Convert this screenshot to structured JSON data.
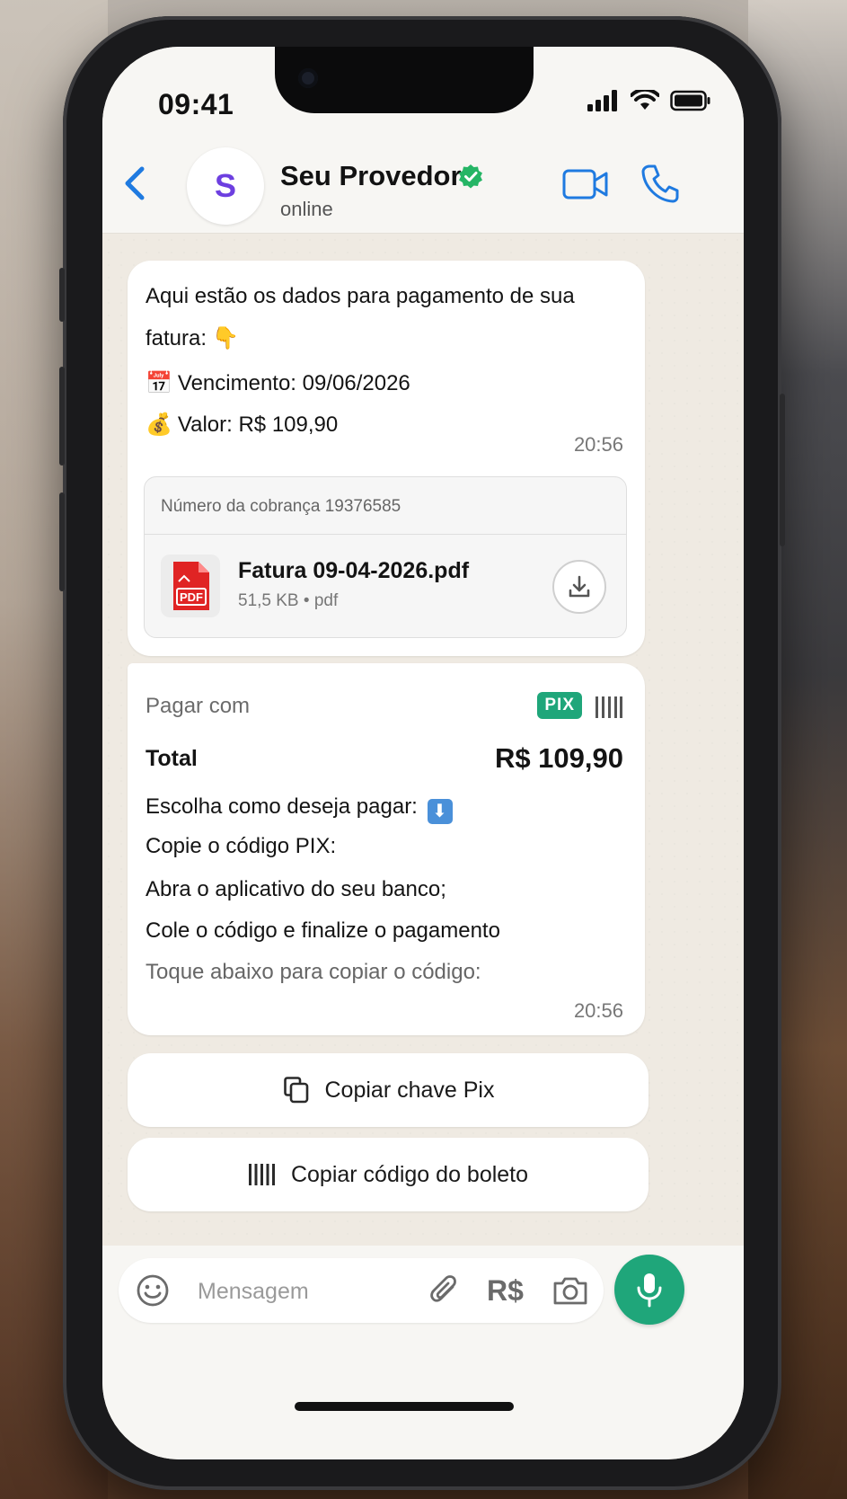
{
  "status": {
    "time": "09:41"
  },
  "header": {
    "avatar_letter": "S",
    "title": "Seu Provedor",
    "subtitle": "online"
  },
  "messages": {
    "invoice": {
      "line1": "Aqui estão os dados para pagamento de sua",
      "line2": "fatura:",
      "line2_emoji": "👇",
      "due_emoji": "📅",
      "due": "Vencimento: 09/06/2026",
      "value_emoji": "💰",
      "value": "Valor: R$ 109,90",
      "timestamp": "20:56",
      "attachment": {
        "header": "Número da cobrança 19376585",
        "file_name": "Fatura 09-04-2026.pdf",
        "file_meta": "51,5 KB • pdf",
        "icon_label": "PDF"
      }
    },
    "payment": {
      "pay_with": "Pagar com",
      "pix_badge": "PIX",
      "total_label": "Total",
      "total_value": "R$ 109,90",
      "choose": "Escolha como deseja pagar:",
      "choose_emoji": "⬇",
      "step1": "Copie o código PIX:",
      "step2": "Abra o aplicativo do seu banco;",
      "step3": "Cole o código e finalize o pagamento",
      "hint": "Toque abaixo para copiar o código:",
      "timestamp": "20:56"
    }
  },
  "actions": {
    "copy_pix": "Copiar chave Pix",
    "copy_boleto": "Copiar código do boleto"
  },
  "composer": {
    "placeholder": "Mensagem",
    "currency_button": "R$"
  },
  "colors": {
    "accent_blue": "#1f7ae0",
    "accent_green": "#1fa67a",
    "avatar_purple": "#6d3fe0",
    "pdf_red": "#e02424"
  }
}
